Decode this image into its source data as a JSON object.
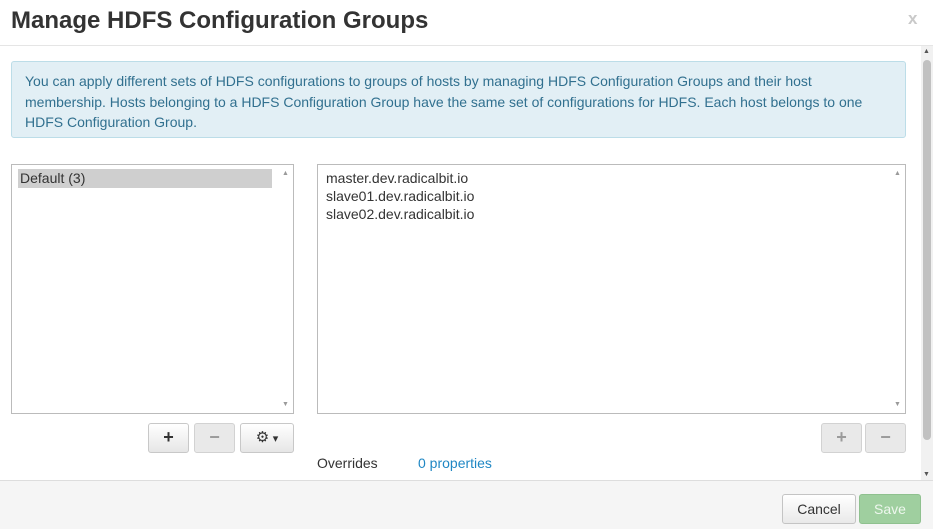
{
  "modal": {
    "title": "Manage HDFS Configuration Groups",
    "close_label": "x"
  },
  "info": {
    "text": "You can apply different sets of HDFS configurations to groups of hosts by managing HDFS Configuration Groups and their host membership. Hosts belonging to a HDFS Configuration Group have the same set of configurations for HDFS. Each host belongs to one HDFS Configuration Group."
  },
  "groups": {
    "items": [
      {
        "label": "Default (3)",
        "selected": true
      }
    ],
    "add_icon": "plus-icon",
    "remove_icon": "minus-icon",
    "settings_icon": "gear-icon",
    "add_label": "+",
    "remove_label": "−",
    "settings_caret": "▾",
    "settings_gear": "⚙"
  },
  "hosts": {
    "items": [
      "master.dev.radicalbit.io",
      "slave01.dev.radicalbit.io",
      "slave02.dev.radicalbit.io"
    ],
    "add_label": "+",
    "remove_label": "−",
    "add_icon": "plus-icon",
    "remove_icon": "minus-icon"
  },
  "overrides": {
    "label": "Overrides",
    "link": "0 properties"
  },
  "footer": {
    "cancel_label": "Cancel",
    "save_label": "Save"
  },
  "colors": {
    "alert_bg": "#e2eff5",
    "alert_text": "#31708f",
    "link": "#1f87c4",
    "save_bg": "#9fcf9f"
  }
}
